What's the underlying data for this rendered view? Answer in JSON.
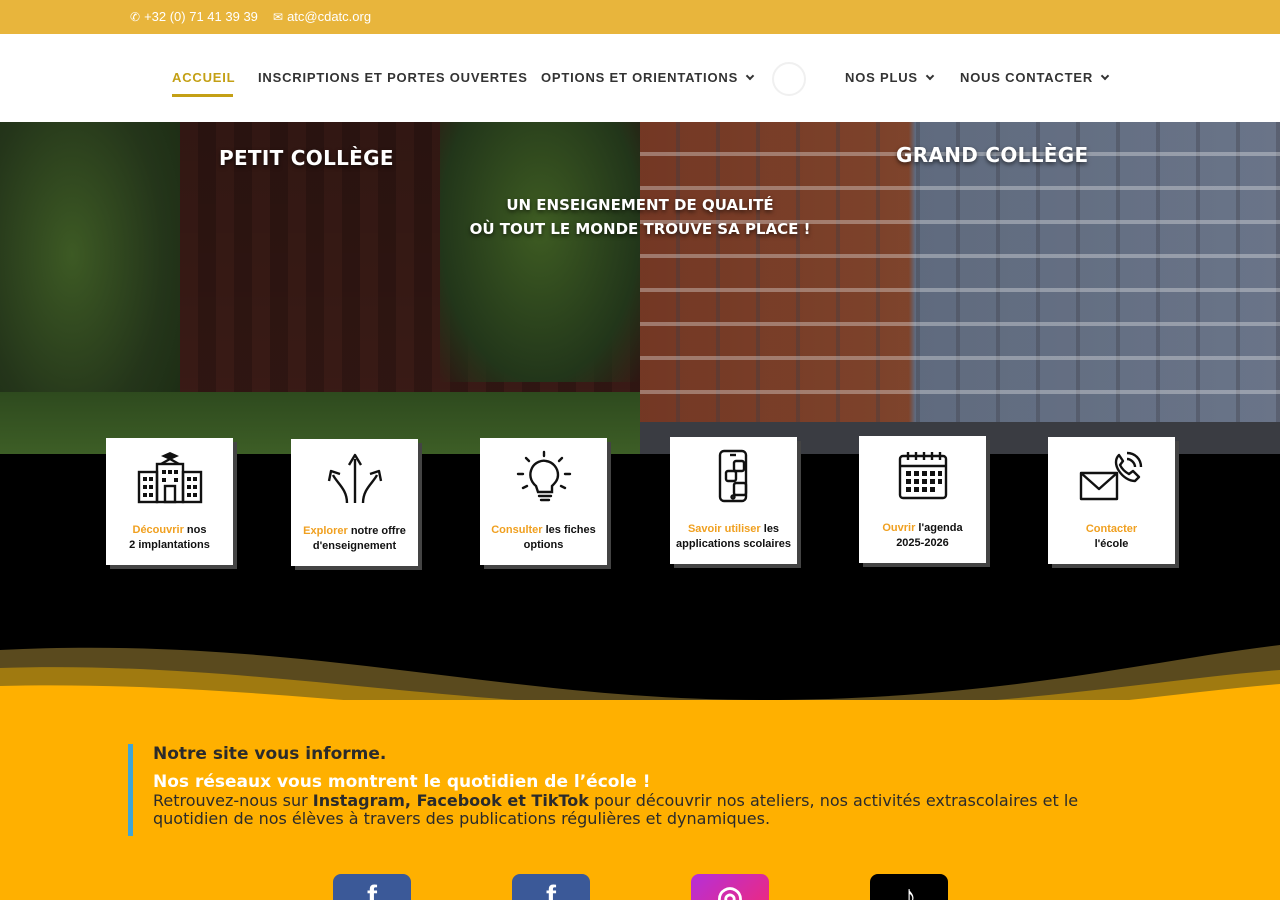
{
  "topbar": {
    "phone": "+32 (0) 71 41 39 39",
    "email": "atc@cdatc.org",
    "color": "#e8b53c"
  },
  "nav": {
    "items": [
      {
        "label": "ACCUEIL",
        "active": true
      },
      {
        "label": "INSCRIPTIONS ET PORTES OUVERTES"
      },
      {
        "label": "OPTIONS ET ORIENTATIONS",
        "dropdown": true
      },
      {
        "label": "NOS PLUS",
        "dropdown": true
      },
      {
        "label": "NOUS CONTACTER",
        "dropdown": true
      }
    ],
    "accent": "#c4a015"
  },
  "hero": {
    "left_label": "PETIT COLLÈGE",
    "right_label": "GRAND COLLÈGE",
    "tagline_1": "UN ENSEIGNEMENT DE QUALITÉ",
    "tagline_2": "OÙ TOUT LE MONDE TROUVE SA PLACE !"
  },
  "cards": [
    {
      "icon": "school-building-icon",
      "highlight": "Découvrir",
      "rest1": " nos",
      "line2": "2 implantations"
    },
    {
      "icon": "directions-arrows-icon",
      "highlight": "Explorer",
      "rest1": " notre offre",
      "line2": "d'enseignement"
    },
    {
      "icon": "lightbulb-icon",
      "highlight": "Consulter",
      "rest1": " les fiches",
      "line2": "options"
    },
    {
      "icon": "mobile-apps-icon",
      "highlight": "Savoir utiliser",
      "rest1": " les",
      "line2": "applications scolaires"
    },
    {
      "icon": "calendar-icon",
      "highlight": "Ouvrir",
      "rest1": " l'agenda",
      "line2": "2025-2026"
    },
    {
      "icon": "mail-phone-icon",
      "highlight": "Contacter",
      "rest1": "",
      "line2": "l'école"
    }
  ],
  "info": {
    "title": "Notre site vous informe.",
    "subtitle": "Nos réseaux vous montrent le quotidien de l’école !",
    "body_pre": "Retrouvez-nous sur ",
    "body_bold": "Instagram, Facebook et TikTok",
    "body_post": " pour découvrir nos ateliers, nos activités extrascolaires et le quotidien de nos élèves à travers des publications régulières et dynamiques."
  },
  "social": [
    {
      "icon": "facebook-icon",
      "glyph": "f"
    },
    {
      "icon": "facebook-icon",
      "glyph": "f"
    },
    {
      "icon": "instagram-icon",
      "glyph": "◎"
    },
    {
      "icon": "tiktok-icon",
      "glyph": "♪"
    }
  ],
  "colors": {
    "yellow": "#ffb000",
    "card_highlight": "#f0a020",
    "quote_bar": "#3fa5d8"
  }
}
